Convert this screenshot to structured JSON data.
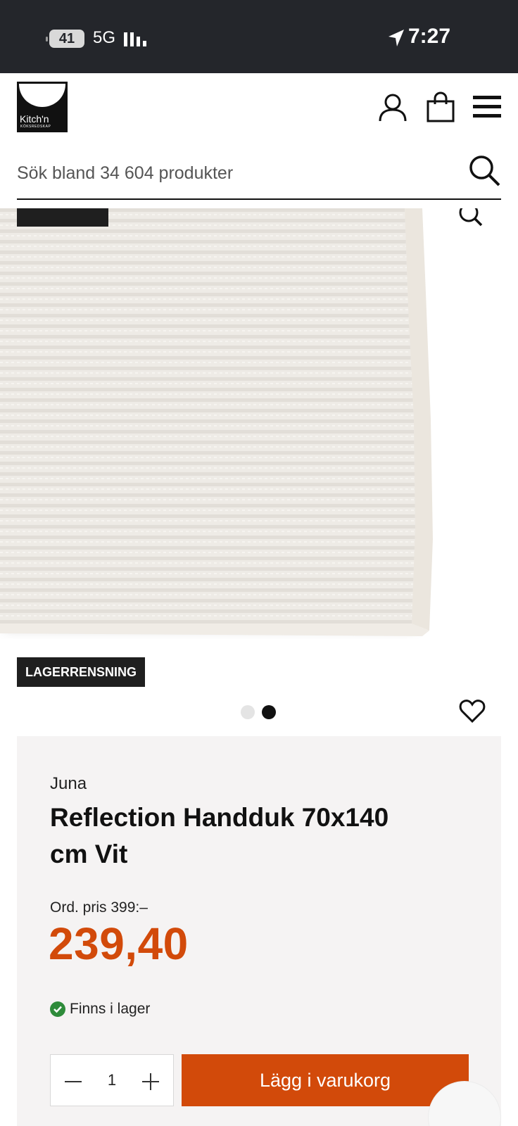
{
  "status_bar": {
    "battery": "41",
    "network": "5G",
    "time": "7:27"
  },
  "header": {
    "logo_text": "Kitch'n",
    "logo_subtext": "KÖKSREDSKAP",
    "icons": [
      "user-icon",
      "shopping-bag-icon",
      "menu-icon"
    ]
  },
  "search": {
    "placeholder": "Sök bland 34 604 produkter"
  },
  "gallery": {
    "badge": "LAGERRENSNING",
    "image_count": 2,
    "active_image": 2
  },
  "product": {
    "brand": "Juna",
    "title": "Reflection Handduk 70x140 cm Vit",
    "ord_price": "Ord. pris 399:–",
    "price": "239,40",
    "stock": "Finns i lager",
    "quantity": "1",
    "add_to_cart": "Lägg i varukorg"
  },
  "colors": {
    "accent": "#d24a0a",
    "status_bar": "#24262b",
    "panel": "#f5f3f3",
    "in_stock": "#2e8b3a"
  }
}
